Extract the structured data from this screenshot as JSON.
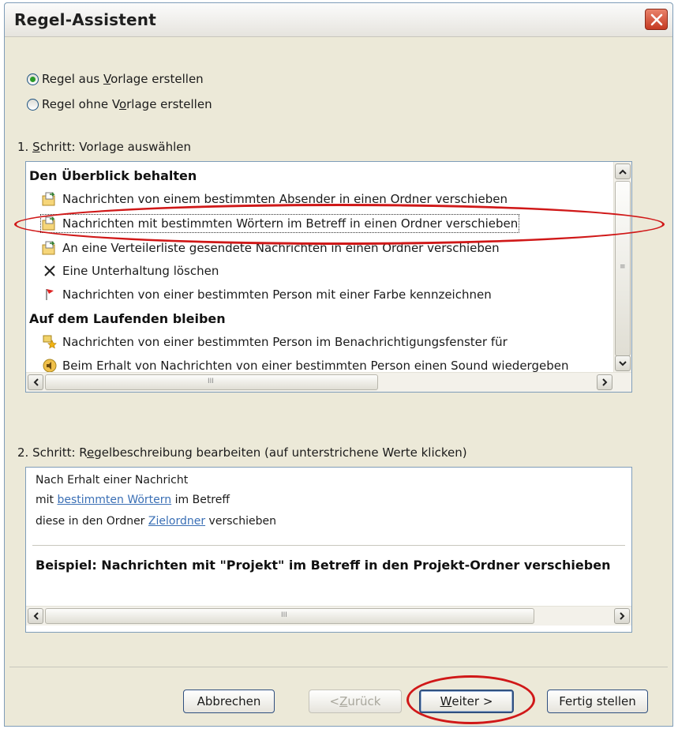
{
  "window": {
    "title": "Regel-Assistent"
  },
  "radios": [
    {
      "label_pre": "Regel aus ",
      "label_u": "V",
      "label_post": "orlage erstellen",
      "checked": true
    },
    {
      "label_pre": "Regel ohne V",
      "label_u": "o",
      "label_post": "rlage erstellen",
      "checked": false
    }
  ],
  "step1": {
    "label_pre": "1. ",
    "label_u": "S",
    "label_post": "chritt: Vorlage auswählen",
    "groups": [
      {
        "header": "Den Überblick behalten",
        "items": [
          {
            "icon": "move-to-folder-icon",
            "text": "Nachrichten von einem bestimmten Absender in einen Ordner verschieben"
          },
          {
            "icon": "move-to-folder-icon",
            "text": "Nachrichten mit bestimmten Wörtern im Betreff in einen Ordner verschieben",
            "selected": true
          },
          {
            "icon": "move-to-folder-icon",
            "text": "An eine Verteilerliste gesendete Nachrichten in einen Ordner verschieben"
          },
          {
            "icon": "delete-x-icon",
            "text": "Eine Unterhaltung löschen"
          },
          {
            "icon": "red-flag-icon",
            "text": "Nachrichten von einer bestimmten Person mit einer Farbe kennzeichnen"
          }
        ]
      },
      {
        "header": "Auf dem Laufenden bleiben",
        "items": [
          {
            "icon": "notification-star-icon",
            "text": "Nachrichten von einer bestimmten Person im Benachrichtigungsfenster für"
          },
          {
            "icon": "sound-icon",
            "text": "Beim Erhalt von Nachrichten von einer bestimmten Person einen Sound wiedergeben"
          }
        ]
      }
    ]
  },
  "step2": {
    "label_pre": "2. Schritt: R",
    "label_u": "e",
    "label_post": "gelbeschreibung bearbeiten (auf unterstrichene Werte klicken)",
    "line1": "Nach Erhalt einer Nachricht",
    "line2_pre": "mit ",
    "line2_link": "bestimmten Wörtern",
    "line2_post": " im Betreff",
    "line3_pre": "diese in den Ordner ",
    "line3_link": "Zielordner",
    "line3_post": " verschieben",
    "example": "Beispiel: Nachrichten mit \"Projekt\" im Betreff in den Projekt-Ordner verschieben"
  },
  "buttons": {
    "cancel": "Abbrechen",
    "back_pre": "< ",
    "back_u": "Z",
    "back_post": "urück",
    "next_u": "W",
    "next_post": "eiter >",
    "finish": "Fertig stellen"
  }
}
